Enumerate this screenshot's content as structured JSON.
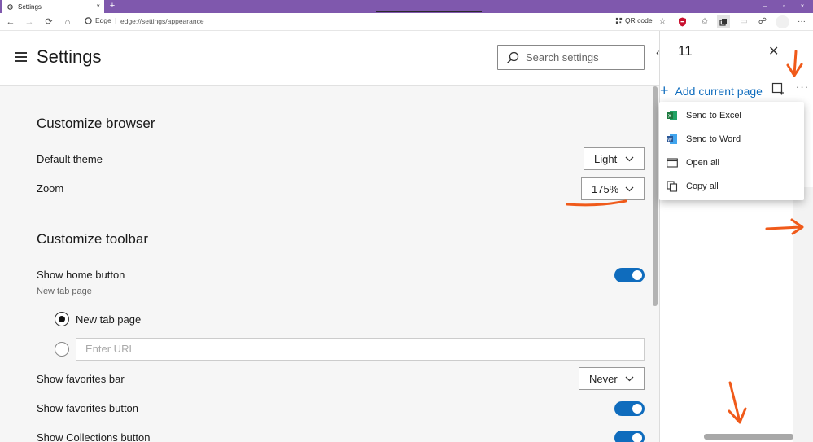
{
  "tab": {
    "title": "Settings",
    "close": "×",
    "new_tab": "+"
  },
  "window": {
    "minimize": "–",
    "maximize": "▫",
    "close": "×"
  },
  "addressbar": {
    "edge_label": "Edge",
    "url": "edge://settings/appearance",
    "qr_label": "QR code"
  },
  "settings": {
    "title": "Settings",
    "search_placeholder": "Search settings",
    "sections": {
      "customize_browser": "Customize browser",
      "customize_toolbar": "Customize toolbar"
    },
    "default_theme": {
      "label": "Default theme",
      "value": "Light"
    },
    "zoom": {
      "label": "Zoom",
      "value": "175%"
    },
    "show_home": {
      "label": "Show home button",
      "sub": "New tab page",
      "on": true
    },
    "home_options": {
      "new_tab": "New tab page",
      "url_placeholder": "Enter URL"
    },
    "show_favorites_bar": {
      "label": "Show favorites bar",
      "value": "Never"
    },
    "show_favorites_button": {
      "label": "Show favorites button",
      "on": true
    },
    "show_collections_button": {
      "label": "Show Collections button",
      "on": true
    }
  },
  "collections": {
    "count": "11",
    "add_current": "Add current page",
    "menu": [
      {
        "label": "Send to Excel",
        "icon": "excel-icon"
      },
      {
        "label": "Send to Word",
        "icon": "word-icon"
      },
      {
        "label": "Open all",
        "icon": "window-icon"
      },
      {
        "label": "Copy all",
        "icon": "copy-icon"
      }
    ]
  },
  "colors": {
    "accent": "#0f6cbd",
    "titlebar": "#7f58ad",
    "annotation": "#f05a1a",
    "excel": "#1d7a3f",
    "word": "#2b5797"
  }
}
